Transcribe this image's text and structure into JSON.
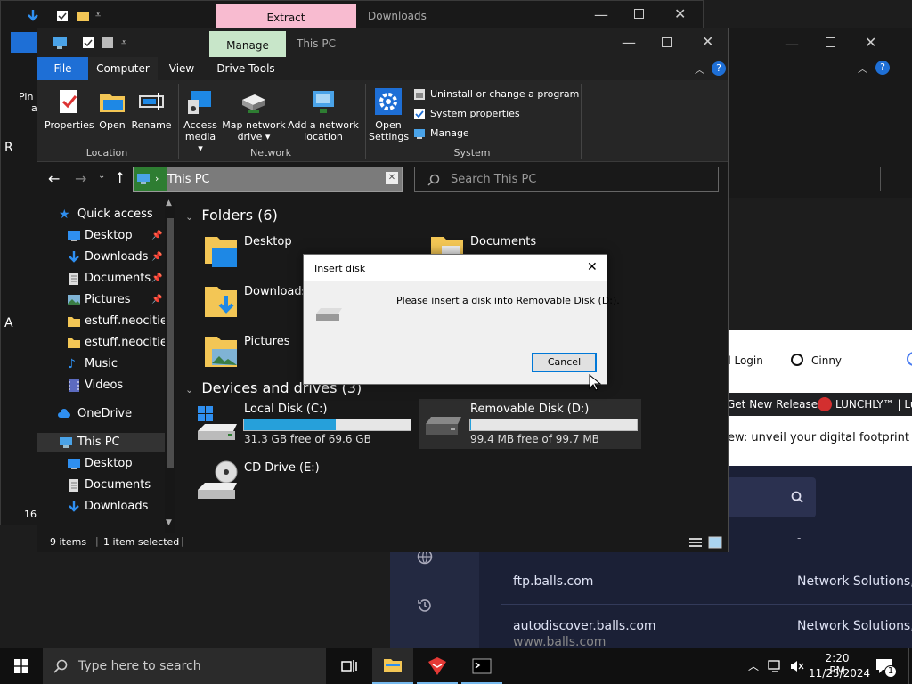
{
  "colors": {
    "accent": "#0078d7",
    "folder": "#f3c655",
    "progress": "#26a0da",
    "manage_tab": "#c8e6c9",
    "extract_tab": "#f8bbd0"
  },
  "back_window": {
    "extract_label": "Extract",
    "title": "Downloads",
    "pin_text": "Pin t",
    "pin_text2": "a",
    "left_char": "R",
    "left_char2": "A",
    "count": "16"
  },
  "browser": {
    "tabs": [
      {
        "label": "il Login"
      },
      {
        "label": "Cinny"
      }
    ],
    "bookmarks": [
      {
        "label": "Get New Releases"
      },
      {
        "label": "LUNCHLY™ | Lur"
      }
    ],
    "banner": "ew: unveil your digital footprint",
    "dash": "-",
    "rows": [
      {
        "domain": "ftp.balls.com",
        "registrar": "Network Solutions, L"
      },
      {
        "domain": "autodiscover.balls.com",
        "registrar": "Network Solutions, L"
      },
      {
        "domain": "www.balls.com",
        "registrar": ""
      }
    ]
  },
  "explorer": {
    "title": "This PC",
    "manage_tab": "Manage",
    "tabs": [
      {
        "label": "File"
      },
      {
        "label": "Computer"
      },
      {
        "label": "View"
      },
      {
        "label": "Drive Tools"
      }
    ],
    "ribbon": {
      "location": {
        "label": "Location",
        "buttons": [
          "Properties",
          "Open",
          "Rename"
        ]
      },
      "network": {
        "label": "Network",
        "buttons": [
          [
            "Access",
            "media ▾"
          ],
          [
            "Map network",
            "drive ▾"
          ],
          [
            "Add a network",
            "location"
          ]
        ]
      },
      "system": {
        "label": "System",
        "open_settings": [
          "Open",
          "Settings"
        ],
        "links": [
          "Uninstall or change a program",
          "System properties",
          "Manage"
        ]
      }
    },
    "address": "This PC",
    "search_placeholder": "Search This PC",
    "nav": [
      {
        "label": "Quick access",
        "icon": "star",
        "pinned": false,
        "indent": 0
      },
      {
        "label": "Desktop",
        "icon": "desktop",
        "pinned": true,
        "indent": 1
      },
      {
        "label": "Downloads",
        "icon": "download",
        "pinned": true,
        "indent": 1
      },
      {
        "label": "Documents",
        "icon": "document",
        "pinned": true,
        "indent": 1
      },
      {
        "label": "Pictures",
        "icon": "picture",
        "pinned": true,
        "indent": 1
      },
      {
        "label": "estuff.neocities",
        "icon": "folder",
        "pinned": false,
        "indent": 1
      },
      {
        "label": "estuff.neocities",
        "icon": "folder",
        "pinned": false,
        "indent": 1
      },
      {
        "label": "Music",
        "icon": "music",
        "pinned": false,
        "indent": 1
      },
      {
        "label": "Videos",
        "icon": "video",
        "pinned": false,
        "indent": 1
      },
      {
        "label": "OneDrive",
        "icon": "cloud",
        "pinned": false,
        "indent": 0
      },
      {
        "label": "This PC",
        "icon": "pc",
        "pinned": false,
        "indent": 0
      },
      {
        "label": "Desktop",
        "icon": "desktop",
        "pinned": false,
        "indent": 1
      },
      {
        "label": "Documents",
        "icon": "document",
        "pinned": false,
        "indent": 1
      },
      {
        "label": "Downloads",
        "icon": "download",
        "pinned": false,
        "indent": 1
      }
    ],
    "folders_header": "Folders (6)",
    "folders": [
      {
        "label": "Desktop"
      },
      {
        "label": "Documents"
      },
      {
        "label": "Downloads"
      },
      {
        "label": "Pictures"
      }
    ],
    "devices_header": "Devices and drives (3)",
    "drives": [
      {
        "name": "Local Disk (C:)",
        "free": "31.3 GB free of 69.6 GB",
        "used_fraction": 0.55
      },
      {
        "name": "Removable Disk (D:)",
        "free": "99.4 MB free of 99.7 MB",
        "used_fraction": 0.003
      },
      {
        "name": "CD Drive (E:)",
        "free": ""
      }
    ],
    "status_items": "9 items",
    "status_selected": "1 item selected"
  },
  "dialog": {
    "title": "Insert disk",
    "message": "Please insert a disk into Removable Disk (D:).",
    "cancel": "Cancel"
  },
  "taskbar": {
    "search_placeholder": "Type here to search",
    "time": "2:20 PM",
    "date": "11/25/2024",
    "notifications": "1"
  }
}
